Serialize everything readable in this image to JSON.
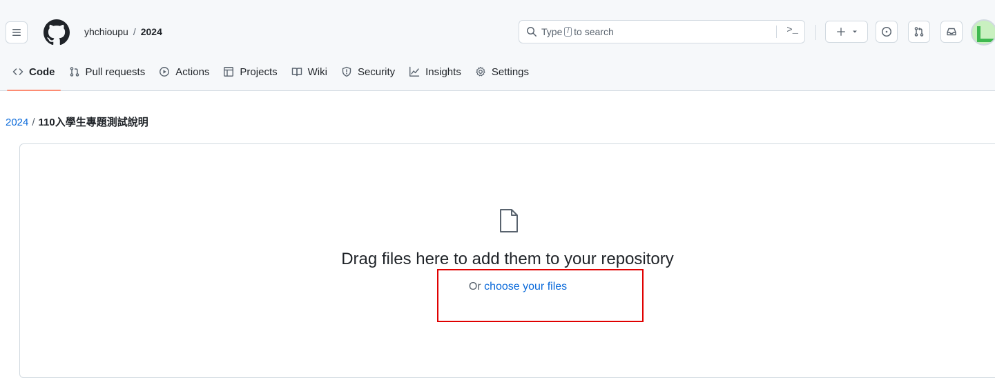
{
  "header": {
    "owner": "yhchioupu",
    "separator": "/",
    "repo": "2024",
    "search": {
      "prefix": "Type",
      "key": "/",
      "suffix": "to search",
      "command_glyph": ">_"
    }
  },
  "tabs": [
    {
      "label": "Code",
      "icon": "code-icon",
      "selected": true
    },
    {
      "label": "Pull requests",
      "icon": "git-pull-request-icon",
      "selected": false
    },
    {
      "label": "Actions",
      "icon": "play-icon",
      "selected": false
    },
    {
      "label": "Projects",
      "icon": "table-icon",
      "selected": false
    },
    {
      "label": "Wiki",
      "icon": "book-icon",
      "selected": false
    },
    {
      "label": "Security",
      "icon": "shield-icon",
      "selected": false
    },
    {
      "label": "Insights",
      "icon": "graph-icon",
      "selected": false
    },
    {
      "label": "Settings",
      "icon": "gear-icon",
      "selected": false
    }
  ],
  "breadcrumb": {
    "repo_link": "2024",
    "separator": "/",
    "current": "110入學生專題測試說明"
  },
  "dropzone": {
    "title": "Drag files here to add them to your repository",
    "or_text": "Or",
    "choose_link": "choose your files"
  },
  "colors": {
    "accent_link": "#0969da",
    "tab_underline": "#fd8c73",
    "highlight_box": "#e00000",
    "header_bg": "#f6f8fa"
  }
}
